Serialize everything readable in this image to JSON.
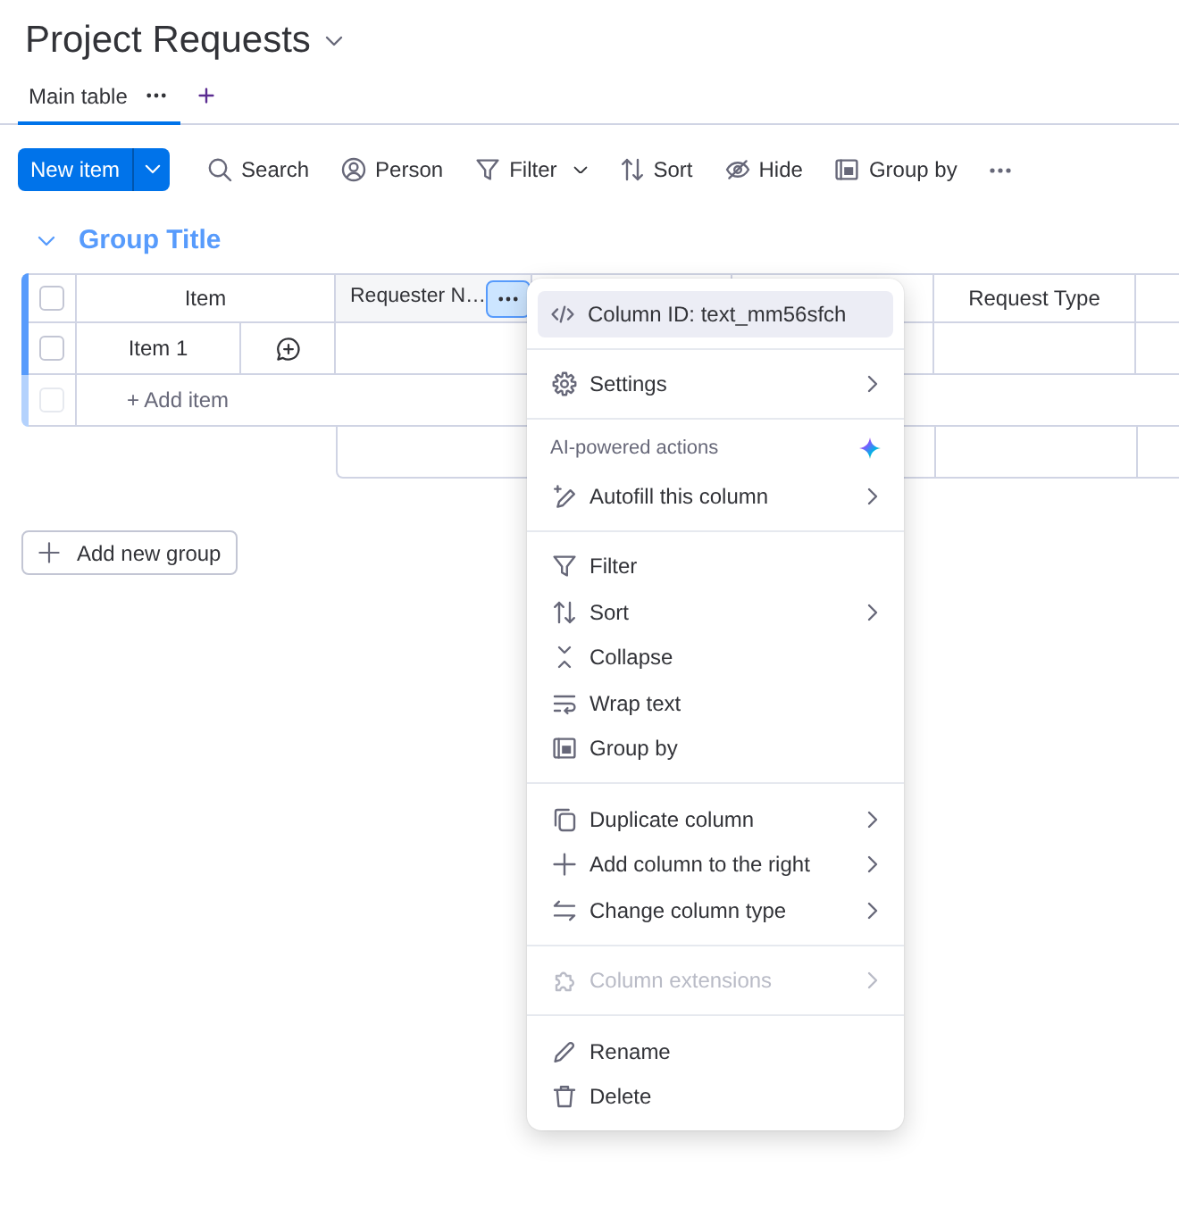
{
  "board": {
    "title": "Project Requests"
  },
  "views": [
    {
      "label": "Main table",
      "selected": true
    }
  ],
  "toolbar": {
    "primary_button": "New item",
    "actions": [
      {
        "kind": "search",
        "label": "Search",
        "dropdown": false
      },
      {
        "kind": "person",
        "label": "Person",
        "dropdown": false
      },
      {
        "kind": "filter",
        "label": "Filter",
        "dropdown": true
      },
      {
        "kind": "sort",
        "label": "Sort",
        "dropdown": false
      },
      {
        "kind": "hide",
        "label": "Hide",
        "dropdown": false
      },
      {
        "kind": "group",
        "label": "Group by",
        "dropdown": false
      }
    ]
  },
  "group": {
    "title": "Group Title",
    "expanded": true,
    "all_checked": false,
    "columns": [
      {
        "kind": "item",
        "label": "Item",
        "menu_open": false
      },
      {
        "kind": "text",
        "label": "Requester N…",
        "menu_open": true
      },
      {
        "kind": "text"
      },
      {
        "kind": "text",
        "menu_open": false
      },
      {
        "kind": "text",
        "label": "Request Type",
        "menu_open": false
      },
      {
        "kind": "text",
        "menu_open": false
      }
    ],
    "rows": [
      {
        "name": "Item 1",
        "checked": false
      }
    ],
    "add_item": {
      "placeholder": "+ Add item",
      "checkbox_disabled": true
    }
  },
  "add_group": "Add new group",
  "column_menu": {
    "sections": [
      {
        "items": [
          {
            "kind": "code",
            "label": "Column ID: text_mm56sfch",
            "submenu": false,
            "disabled": false,
            "highlighted": true
          }
        ]
      },
      {
        "items": [
          {
            "kind": "settings",
            "label": "Settings",
            "submenu": true,
            "disabled": false,
            "highlighted": false
          }
        ]
      },
      {
        "heading": "AI-powered actions",
        "items": [
          {
            "kind": "autofill",
            "label": "Autofill this column",
            "submenu": true,
            "disabled": false,
            "highlighted": false
          }
        ]
      },
      {
        "items": [
          {
            "kind": "filter",
            "label": "Filter",
            "submenu": false,
            "disabled": false,
            "highlighted": false
          },
          {
            "kind": "sort",
            "label": "Sort",
            "submenu": true,
            "disabled": false,
            "highlighted": false
          },
          {
            "kind": "collapse",
            "label": "Collapse",
            "submenu": false,
            "disabled": false,
            "highlighted": false
          },
          {
            "kind": "wrap",
            "label": "Wrap text",
            "submenu": false,
            "disabled": false,
            "highlighted": false
          },
          {
            "kind": "group",
            "label": "Group by",
            "submenu": false,
            "disabled": false,
            "highlighted": false
          }
        ]
      },
      {
        "items": [
          {
            "kind": "duplicate",
            "label": "Duplicate column",
            "submenu": true,
            "disabled": false,
            "highlighted": false
          },
          {
            "kind": "add",
            "label": "Add column to the right",
            "submenu": true,
            "disabled": false,
            "highlighted": false
          },
          {
            "kind": "change_type",
            "label": "Change column type",
            "submenu": true,
            "disabled": false,
            "highlighted": false
          }
        ]
      },
      {
        "items": [
          {
            "kind": "extensions",
            "label": "Column extensions",
            "submenu": true,
            "disabled": true,
            "highlighted": false
          }
        ]
      },
      {
        "items": [
          {
            "kind": "rename",
            "label": "Rename",
            "submenu": false,
            "disabled": false,
            "highlighted": false
          },
          {
            "kind": "delete",
            "label": "Delete",
            "submenu": false,
            "disabled": false,
            "highlighted": false
          }
        ]
      }
    ]
  }
}
